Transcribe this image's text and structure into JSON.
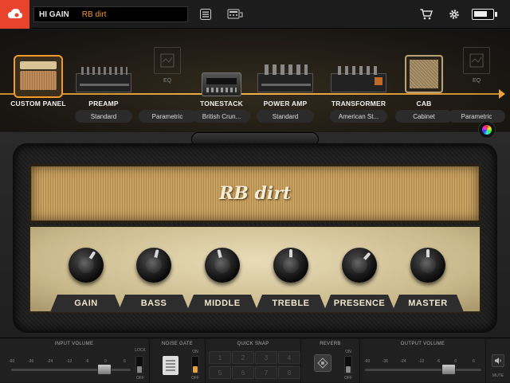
{
  "topbar": {
    "logo_icon": "cloud-logo-icon",
    "preset_bank": "HI GAIN",
    "preset_name": "RB dirt",
    "icons": [
      "preset-list-icon",
      "amp-settings-icon",
      "cart-icon",
      "gear-icon",
      "battery-icon"
    ],
    "battery_level": 0.8,
    "accent": "#e8432c",
    "preset_color": "#f39a2b"
  },
  "chain": {
    "modules": [
      {
        "label": "CUSTOM PANEL",
        "pill": ""
      },
      {
        "label": "PREAMP",
        "pill": "Standard"
      },
      {
        "label": "",
        "pill": "Parametric",
        "eq_label": "EQ"
      },
      {
        "label": "TONESTACK",
        "pill": "British Crun..."
      },
      {
        "label": "POWER AMP",
        "pill": "Standard"
      },
      {
        "label": "TRANSFORMER",
        "pill": "American St..."
      },
      {
        "label": "CAB",
        "pill": "Cabinet"
      },
      {
        "label": "",
        "pill": "Parametric",
        "eq_label": "EQ"
      }
    ],
    "signal_color": "#f3b04a"
  },
  "amp": {
    "logo": "RB dirt",
    "knobs": [
      {
        "label": "GAIN",
        "value": 0.62
      },
      {
        "label": "BASS",
        "value": 0.55
      },
      {
        "label": "MIDDLE",
        "value": 0.45
      },
      {
        "label": "TREBLE",
        "value": 0.5
      },
      {
        "label": "PRESENCE",
        "value": 0.65
      },
      {
        "label": "MASTER",
        "value": 0.5
      }
    ]
  },
  "controls": {
    "input_volume": {
      "title": "INPUT VOLUME",
      "scale": [
        "-60",
        "-36",
        "-24",
        "-12",
        "-6",
        "0",
        "6"
      ],
      "lock_label": "LOCK",
      "off_label": "OFF",
      "level": 0.78
    },
    "noise_gate": {
      "title": "NOISE GATE",
      "on_label": "ON",
      "off_label": "OFF"
    },
    "quick_snap": {
      "title": "QUICK SNAP",
      "buttons": [
        "1",
        "2",
        "3",
        "4",
        "5",
        "6",
        "7",
        "8"
      ]
    },
    "reverb": {
      "title": "REVERB",
      "on_label": "ON",
      "off_label": "OFF"
    },
    "output_volume": {
      "title": "OUTPUT VOLUME",
      "scale": [
        "-60",
        "-36",
        "-24",
        "-12",
        "-6",
        "0",
        "6"
      ],
      "level": 0.72,
      "mute_label": "MUTE"
    }
  }
}
